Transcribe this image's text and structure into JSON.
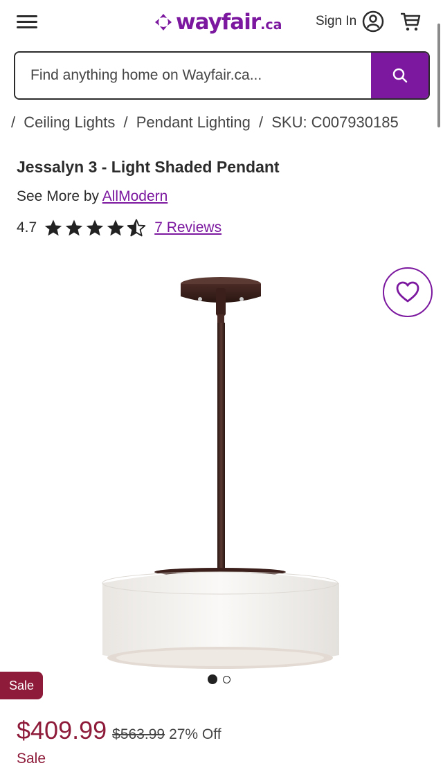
{
  "header": {
    "logo_text": "wayfair",
    "logo_suffix": ".ca",
    "signin_label": "Sign In",
    "accent_color": "#7b189f"
  },
  "search": {
    "placeholder": "Find anything home on Wayfair.ca..."
  },
  "breadcrumb": {
    "items": [
      "Ceiling Lights",
      "Pendant Lighting",
      "SKU: C007930185"
    ]
  },
  "product": {
    "title": "Jessalyn 3 - Light Shaded Pendant",
    "see_more_prefix": "See More by",
    "brand": "AllModern",
    "rating_value": "4.7",
    "rating_stars": 4.5,
    "reviews_label": "7 Reviews",
    "image_count": 2,
    "active_image": 1
  },
  "pricing": {
    "badge": "Sale",
    "price": "$409.99",
    "original_price": "$563.99",
    "discount": "27% Off",
    "status": "Sale",
    "sale_color": "#8e1b3a"
  }
}
